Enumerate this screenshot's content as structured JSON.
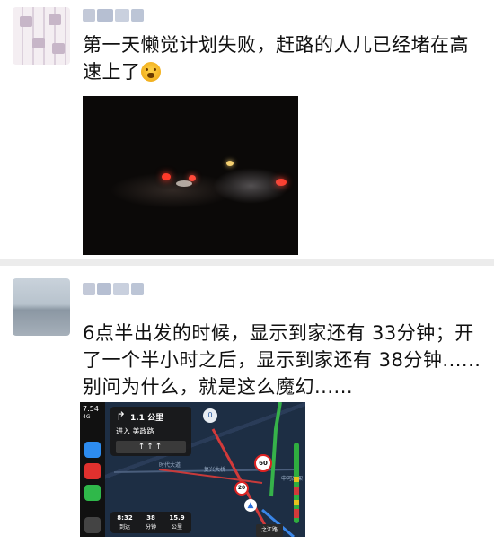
{
  "feed": {
    "posts": [
      {
        "author": "",
        "text": "第一天懒觉计划失败，赶路的人儿已经堵在高速上了",
        "emoji_icon": "grimace-emoji-icon"
      },
      {
        "author": "",
        "text": "6点半出发的时候，显示到家还有 33分钟；开了一个半小时之后，显示到家还有 38分钟......别问为什么，就是这么魔幻......"
      }
    ]
  },
  "carplay": {
    "time": "7:54",
    "signal": "4G",
    "apps": [
      {
        "icon": "navigation-app-icon",
        "color": "#2d8cf0"
      },
      {
        "icon": "music-app-icon",
        "color": "#e0312e"
      },
      {
        "icon": "phone-app-icon",
        "color": "#2fb84a"
      },
      {
        "icon": "app-grid-icon",
        "color": "#444444"
      }
    ],
    "nav": {
      "distance": "1.1 公里",
      "road": "进入 美政路",
      "lanes": "↑↑↑"
    },
    "trip": {
      "arrival": {
        "value": "8:32",
        "label": "到达"
      },
      "minutes": {
        "value": "38",
        "label": "分钟"
      },
      "km": {
        "value": "15.9",
        "label": "公里"
      }
    },
    "compass": "0",
    "speed_limit_1": "60",
    "speed_limit_2": "20",
    "road_labels": {
      "a": "时代大道",
      "b": "复兴大桥",
      "c": "中河高架"
    },
    "destination": "之江路"
  }
}
